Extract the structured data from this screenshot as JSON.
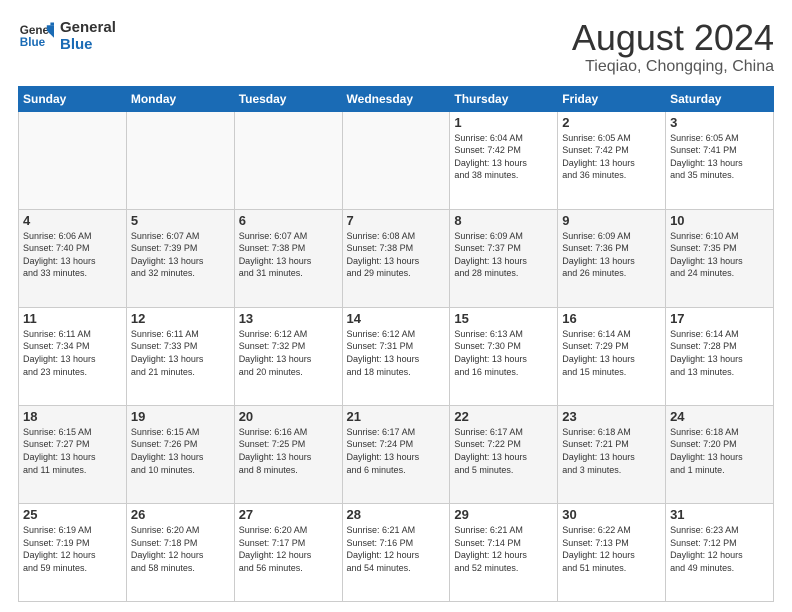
{
  "header": {
    "logo_line1": "General",
    "logo_line2": "Blue",
    "month_title": "August 2024",
    "location": "Tieqiao, Chongqing, China"
  },
  "days_of_week": [
    "Sunday",
    "Monday",
    "Tuesday",
    "Wednesday",
    "Thursday",
    "Friday",
    "Saturday"
  ],
  "weeks": [
    [
      {
        "day": "",
        "info": ""
      },
      {
        "day": "",
        "info": ""
      },
      {
        "day": "",
        "info": ""
      },
      {
        "day": "",
        "info": ""
      },
      {
        "day": "1",
        "info": "Sunrise: 6:04 AM\nSunset: 7:42 PM\nDaylight: 13 hours\nand 38 minutes."
      },
      {
        "day": "2",
        "info": "Sunrise: 6:05 AM\nSunset: 7:42 PM\nDaylight: 13 hours\nand 36 minutes."
      },
      {
        "day": "3",
        "info": "Sunrise: 6:05 AM\nSunset: 7:41 PM\nDaylight: 13 hours\nand 35 minutes."
      }
    ],
    [
      {
        "day": "4",
        "info": "Sunrise: 6:06 AM\nSunset: 7:40 PM\nDaylight: 13 hours\nand 33 minutes."
      },
      {
        "day": "5",
        "info": "Sunrise: 6:07 AM\nSunset: 7:39 PM\nDaylight: 13 hours\nand 32 minutes."
      },
      {
        "day": "6",
        "info": "Sunrise: 6:07 AM\nSunset: 7:38 PM\nDaylight: 13 hours\nand 31 minutes."
      },
      {
        "day": "7",
        "info": "Sunrise: 6:08 AM\nSunset: 7:38 PM\nDaylight: 13 hours\nand 29 minutes."
      },
      {
        "day": "8",
        "info": "Sunrise: 6:09 AM\nSunset: 7:37 PM\nDaylight: 13 hours\nand 28 minutes."
      },
      {
        "day": "9",
        "info": "Sunrise: 6:09 AM\nSunset: 7:36 PM\nDaylight: 13 hours\nand 26 minutes."
      },
      {
        "day": "10",
        "info": "Sunrise: 6:10 AM\nSunset: 7:35 PM\nDaylight: 13 hours\nand 24 minutes."
      }
    ],
    [
      {
        "day": "11",
        "info": "Sunrise: 6:11 AM\nSunset: 7:34 PM\nDaylight: 13 hours\nand 23 minutes."
      },
      {
        "day": "12",
        "info": "Sunrise: 6:11 AM\nSunset: 7:33 PM\nDaylight: 13 hours\nand 21 minutes."
      },
      {
        "day": "13",
        "info": "Sunrise: 6:12 AM\nSunset: 7:32 PM\nDaylight: 13 hours\nand 20 minutes."
      },
      {
        "day": "14",
        "info": "Sunrise: 6:12 AM\nSunset: 7:31 PM\nDaylight: 13 hours\nand 18 minutes."
      },
      {
        "day": "15",
        "info": "Sunrise: 6:13 AM\nSunset: 7:30 PM\nDaylight: 13 hours\nand 16 minutes."
      },
      {
        "day": "16",
        "info": "Sunrise: 6:14 AM\nSunset: 7:29 PM\nDaylight: 13 hours\nand 15 minutes."
      },
      {
        "day": "17",
        "info": "Sunrise: 6:14 AM\nSunset: 7:28 PM\nDaylight: 13 hours\nand 13 minutes."
      }
    ],
    [
      {
        "day": "18",
        "info": "Sunrise: 6:15 AM\nSunset: 7:27 PM\nDaylight: 13 hours\nand 11 minutes."
      },
      {
        "day": "19",
        "info": "Sunrise: 6:15 AM\nSunset: 7:26 PM\nDaylight: 13 hours\nand 10 minutes."
      },
      {
        "day": "20",
        "info": "Sunrise: 6:16 AM\nSunset: 7:25 PM\nDaylight: 13 hours\nand 8 minutes."
      },
      {
        "day": "21",
        "info": "Sunrise: 6:17 AM\nSunset: 7:24 PM\nDaylight: 13 hours\nand 6 minutes."
      },
      {
        "day": "22",
        "info": "Sunrise: 6:17 AM\nSunset: 7:22 PM\nDaylight: 13 hours\nand 5 minutes."
      },
      {
        "day": "23",
        "info": "Sunrise: 6:18 AM\nSunset: 7:21 PM\nDaylight: 13 hours\nand 3 minutes."
      },
      {
        "day": "24",
        "info": "Sunrise: 6:18 AM\nSunset: 7:20 PM\nDaylight: 13 hours\nand 1 minute."
      }
    ],
    [
      {
        "day": "25",
        "info": "Sunrise: 6:19 AM\nSunset: 7:19 PM\nDaylight: 12 hours\nand 59 minutes."
      },
      {
        "day": "26",
        "info": "Sunrise: 6:20 AM\nSunset: 7:18 PM\nDaylight: 12 hours\nand 58 minutes."
      },
      {
        "day": "27",
        "info": "Sunrise: 6:20 AM\nSunset: 7:17 PM\nDaylight: 12 hours\nand 56 minutes."
      },
      {
        "day": "28",
        "info": "Sunrise: 6:21 AM\nSunset: 7:16 PM\nDaylight: 12 hours\nand 54 minutes."
      },
      {
        "day": "29",
        "info": "Sunrise: 6:21 AM\nSunset: 7:14 PM\nDaylight: 12 hours\nand 52 minutes."
      },
      {
        "day": "30",
        "info": "Sunrise: 6:22 AM\nSunset: 7:13 PM\nDaylight: 12 hours\nand 51 minutes."
      },
      {
        "day": "31",
        "info": "Sunrise: 6:23 AM\nSunset: 7:12 PM\nDaylight: 12 hours\nand 49 minutes."
      }
    ]
  ]
}
